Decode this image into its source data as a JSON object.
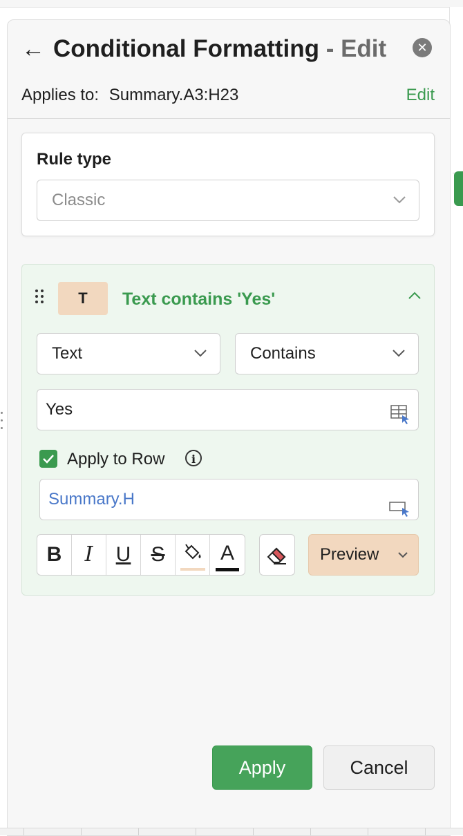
{
  "header": {
    "back_icon": "arrow-left-icon",
    "title": "Conditional Formatting",
    "title_suffix": "- Edit",
    "close_icon": "close-circle-icon",
    "applies_label": "Applies to:",
    "applies_range": "Summary.A3:H23",
    "edit_link": "Edit"
  },
  "rule_type": {
    "label": "Rule type",
    "value": "Classic"
  },
  "condition": {
    "badge": "T",
    "title": "Text contains 'Yes'",
    "field_select": "Text",
    "operator_select": "Contains",
    "value": "Yes",
    "apply_to_row_label": "Apply to Row",
    "apply_to_row_checked": true,
    "row_reference": "Summary.H",
    "format_buttons": {
      "bold": "B",
      "italic": "I",
      "underline": "U",
      "strikethrough": "S",
      "font_color": "A"
    },
    "preview_label": "Preview",
    "fill_color": "#f2d8bf"
  },
  "footer": {
    "apply_label": "Apply",
    "cancel_label": "Cancel"
  },
  "colors": {
    "accent": "#3a9a4f",
    "link_blue": "#4a78c9"
  }
}
